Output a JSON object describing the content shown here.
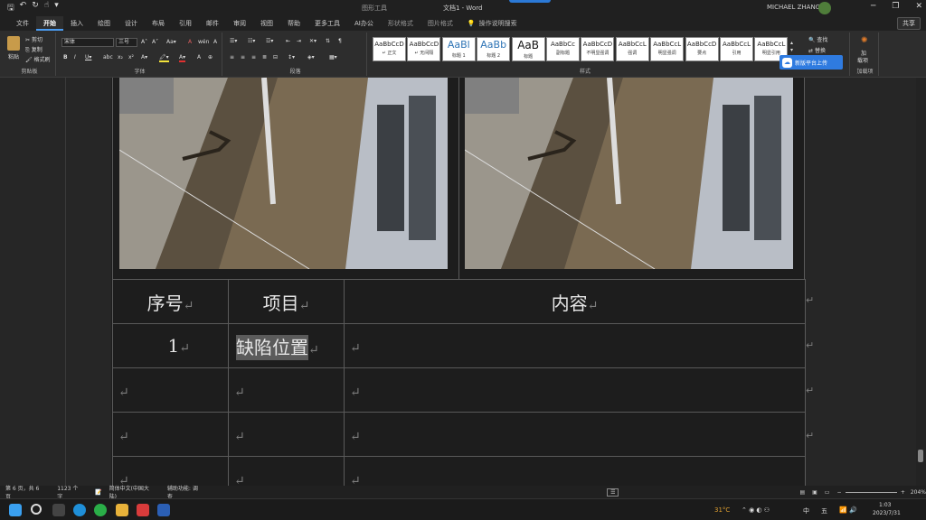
{
  "window": {
    "context_tab": "图形工具",
    "title": "文档1 - Word",
    "user": "MICHAEL ZHANG",
    "controls": [
      "─",
      "❐",
      "✕"
    ]
  },
  "tabs": [
    "文件",
    "开始",
    "插入",
    "绘图",
    "设计",
    "布局",
    "引用",
    "邮件",
    "审阅",
    "视图",
    "帮助",
    "更多工具",
    "AI办公",
    "形状格式"
  ],
  "tab_extra": "图片格式",
  "search_hint": "操作说明搜索",
  "share_label": "共享",
  "ribbon": {
    "clipboard": {
      "label": "剪贴板",
      "paste": "粘贴",
      "cut": "剪切",
      "copy": "复制",
      "format_painter": "格式刷"
    },
    "font": {
      "label": "字体",
      "font_name": "宋体",
      "font_size": "三号"
    },
    "paragraph": {
      "label": "段落"
    },
    "styles": {
      "label": "样式",
      "items": [
        {
          "sample": "AaBbCcD",
          "name": "↵ 正文"
        },
        {
          "sample": "AaBbCcD",
          "name": "↵ 无间隔"
        },
        {
          "sample": "AaBl",
          "name": "标题 1"
        },
        {
          "sample": "AaBb",
          "name": "标题 2"
        },
        {
          "sample": "AaB",
          "name": "标题"
        },
        {
          "sample": "AaBbCc",
          "name": "副标题"
        },
        {
          "sample": "AaBbCcD",
          "name": "不明显强调"
        },
        {
          "sample": "AaBbCcL",
          "name": "强调"
        },
        {
          "sample": "AaBbCcL",
          "name": "明显强调"
        },
        {
          "sample": "AaBbCcD",
          "name": "要点"
        },
        {
          "sample": "AaBbCcL",
          "name": "引用"
        },
        {
          "sample": "AaBbCcL",
          "name": "明显引用"
        }
      ]
    },
    "editing": {
      "find": "查找",
      "replace": "替换"
    },
    "addins": {
      "line1": "加",
      "line2": "载项",
      "label": "加载项"
    },
    "upload_button": "新版平台上传"
  },
  "table": {
    "header": [
      "序号",
      "项目",
      "内容"
    ],
    "rows": [
      [
        "1",
        "缺陷位置",
        ""
      ],
      [
        "",
        "",
        ""
      ],
      [
        "",
        "",
        ""
      ],
      [
        "",
        "",
        ""
      ]
    ],
    "paragraph_mark": "↵"
  },
  "statusbar": {
    "page": "第 6 页，共 6 页",
    "words": "1123 个字",
    "language": "简体中文(中国大陆)",
    "accessibility": "辅助功能: 调查",
    "zoom": "204%"
  },
  "taskbar": {
    "weather_temp": "31°C",
    "ime_lang": "中",
    "ime_mode": "五",
    "time": "1:03",
    "date": "2023/7/31"
  },
  "colors": {
    "accent": "#2b79d6",
    "upload": "#2f7be0"
  }
}
